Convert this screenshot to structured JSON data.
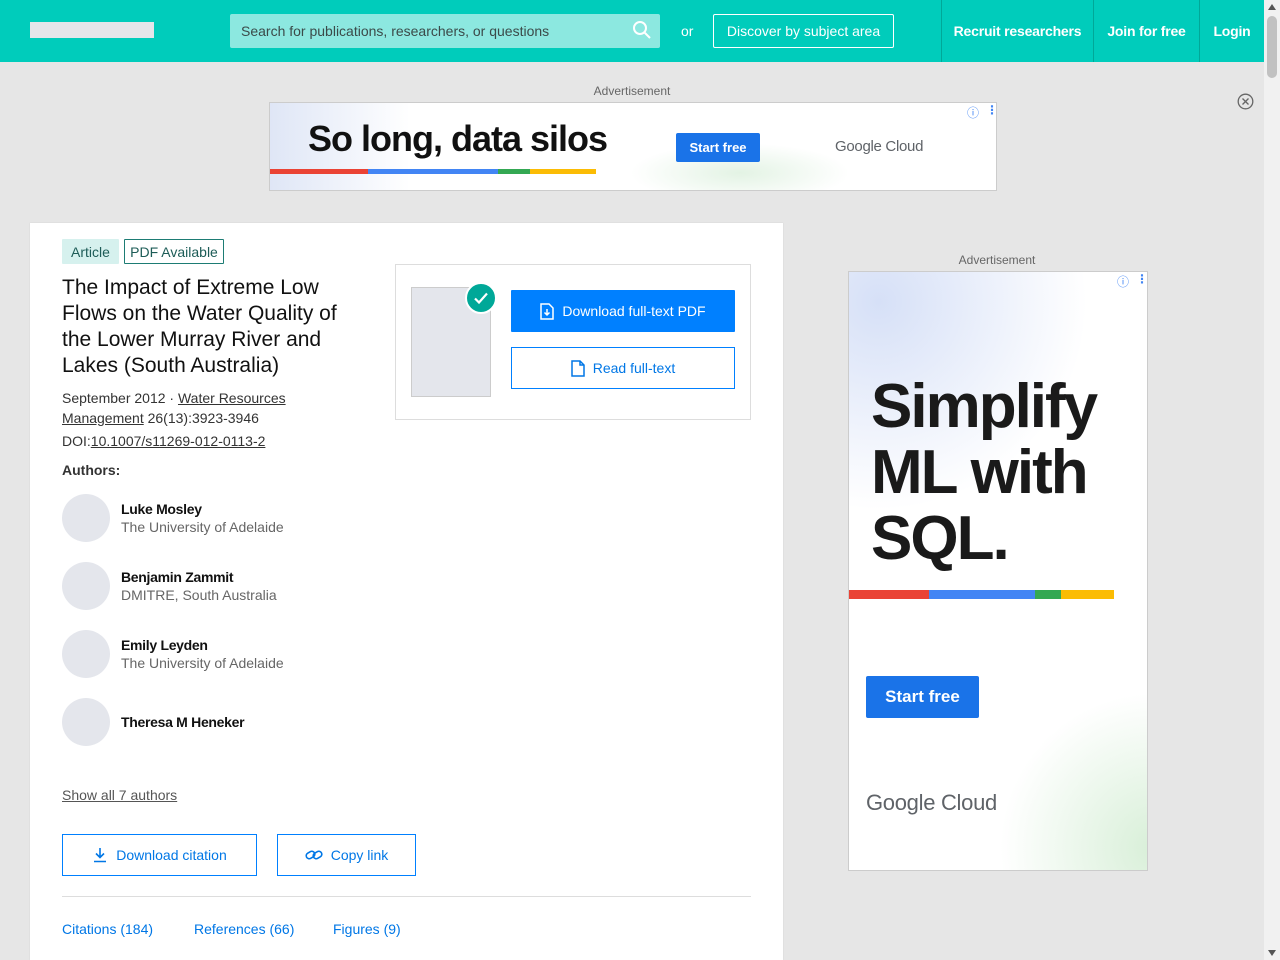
{
  "header": {
    "search_placeholder": "Search for publications, researchers, or questions",
    "or_text": "or",
    "discover_label": "Discover by subject area",
    "nav": [
      "Recruit researchers",
      "Join for free",
      "Login"
    ]
  },
  "ads": {
    "label": "Advertisement",
    "banner": {
      "headline": "So long, data silos",
      "cta": "Start free",
      "brand": "Google Cloud"
    },
    "side": {
      "headline_lines": [
        "Simplify",
        "ML with",
        "SQL."
      ],
      "cta": "Start free",
      "brand": "Google Cloud"
    }
  },
  "publication": {
    "badges": [
      "Article",
      "PDF Available"
    ],
    "title": "The Impact of Extreme Low Flows on the Water Quality of the Lower Murray River and Lakes (South Australia)",
    "date": "September 2012",
    "separator": " · ",
    "journal": "Water Resources Management",
    "volume_pages": " 26(13):3923-3946",
    "doi_label": "DOI:",
    "doi": "10.1007/s11269-012-0113-2",
    "authors_label": "Authors:",
    "authors": [
      {
        "name": "Luke Mosley",
        "institution": "The University of Adelaide"
      },
      {
        "name": "Benjamin Zammit",
        "institution": "DMITRE, South Australia"
      },
      {
        "name": "Emily Leyden",
        "institution": "The University of Adelaide"
      },
      {
        "name": "Theresa M Heneker",
        "institution": ""
      }
    ],
    "show_all": "Show all 7 authors",
    "download_pdf": "Download full-text PDF",
    "read_fulltext": "Read full-text",
    "download_citation": "Download citation",
    "copy_link": "Copy link",
    "tabs": [
      "Citations (184)",
      "References (66)",
      "Figures (9)"
    ]
  },
  "colors": {
    "brand_teal": "#00ccbb",
    "action_blue": "#0080ff",
    "google_blue": "#1a73e8",
    "stripe": [
      "#ea4335",
      "#4285f4",
      "#34a853",
      "#fbbc04"
    ]
  }
}
